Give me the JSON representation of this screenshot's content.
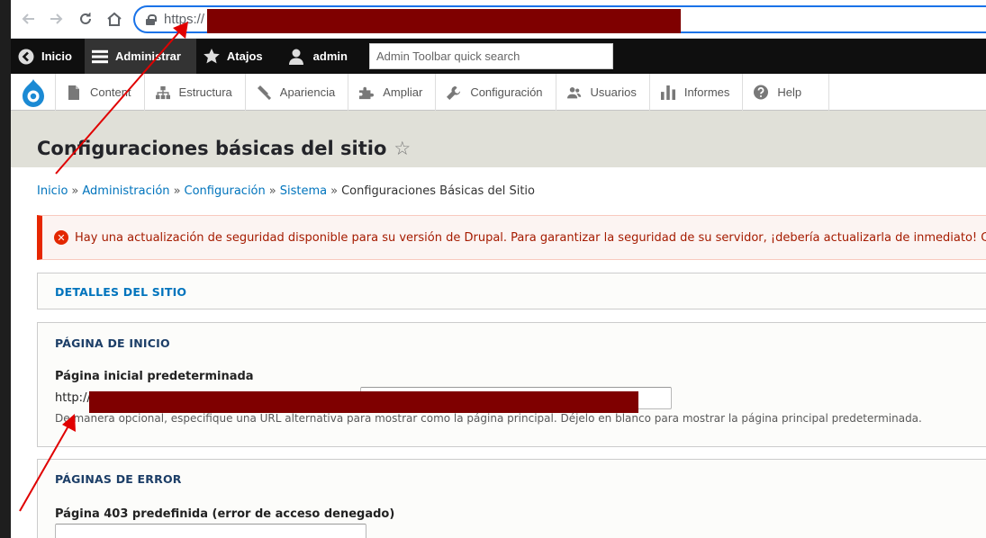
{
  "browser": {
    "url_prefix": "https://",
    "nav_icons": [
      "back-icon",
      "forward-icon",
      "reload-icon",
      "home-icon"
    ]
  },
  "toolbar": {
    "items": [
      {
        "label": "Inicio",
        "icon": "back-circle-icon"
      },
      {
        "label": "Administrar",
        "icon": "menu-icon"
      },
      {
        "label": "Atajos",
        "icon": "star-icon"
      },
      {
        "label": "admin",
        "icon": "user-icon"
      }
    ],
    "search_placeholder": "Admin Toolbar quick search"
  },
  "tray": {
    "items": [
      {
        "label": "Content",
        "icon": "file-icon"
      },
      {
        "label": "Estructura",
        "icon": "structure-icon"
      },
      {
        "label": "Apariencia",
        "icon": "brush-icon"
      },
      {
        "label": "Ampliar",
        "icon": "puzzle-icon"
      },
      {
        "label": "Configuración",
        "icon": "wrench-icon"
      },
      {
        "label": "Usuarios",
        "icon": "users-icon"
      },
      {
        "label": "Informes",
        "icon": "bar-chart-icon"
      },
      {
        "label": "Help",
        "icon": "help-icon"
      }
    ]
  },
  "page": {
    "title": "Configuraciones básicas del sitio"
  },
  "breadcrumb": {
    "links": [
      "Inicio",
      "Administración",
      "Configuración",
      "Sistema"
    ],
    "current": "Configuraciones Básicas del Sitio"
  },
  "message": {
    "text": "Hay una actualización de seguridad disponible para su versión de Drupal. Para garantizar la seguridad de su servidor, ¡debería actualizarla de inmediato! C"
  },
  "sections": {
    "site_details": {
      "title": "DETALLES DEL SITIO"
    },
    "front_page": {
      "title": "PÁGINA DE INICIO",
      "label": "Página inicial predeterminada",
      "prefix": "http://",
      "description": "De manera opcional, especifique una URL alternativa para mostrar como la página principal. Déjelo en blanco para mostrar la página principal predeterminada."
    },
    "error_pages": {
      "title": "PÁGINAS DE ERROR",
      "label_403": "Página 403 predefinida (error de acceso denegado)"
    }
  },
  "colors": {
    "link": "#0074bd",
    "error_accent": "#e62600",
    "redaction": "#7f0000",
    "annotation_arrow": "#e00000"
  }
}
